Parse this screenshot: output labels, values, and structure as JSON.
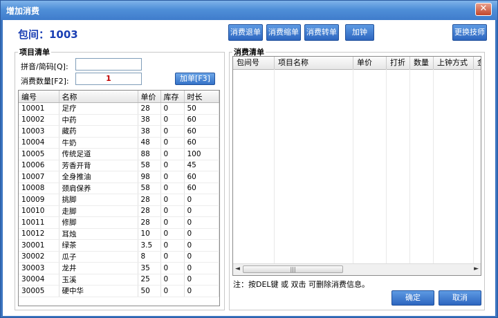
{
  "window": {
    "title": "增加消费",
    "close_glyph": "✕"
  },
  "room": {
    "title": "包间：1003"
  },
  "toolbar": {
    "buttons": [
      "消费退单",
      "消费缩单",
      "消费转单",
      "加钟",
      "更换技师"
    ]
  },
  "item_list": {
    "group_title": "项目清单",
    "pinyin_label": "拼音/简码[Q]:",
    "pinyin_value": "",
    "qty_label": "消费数量[F2]:",
    "qty_value": "1",
    "add_button": "加单[F3]",
    "columns": [
      "编号",
      "名称",
      "单价",
      "库存",
      "时长"
    ],
    "rows": [
      [
        "10001",
        "足疗",
        "28",
        "0",
        "50"
      ],
      [
        "10002",
        "中药",
        "38",
        "0",
        "60"
      ],
      [
        "10003",
        "藏药",
        "38",
        "0",
        "60"
      ],
      [
        "10004",
        "牛奶",
        "48",
        "0",
        "60"
      ],
      [
        "10005",
        "传统足道",
        "88",
        "0",
        "100"
      ],
      [
        "10006",
        "芳香开背",
        "58",
        "0",
        "45"
      ],
      [
        "10007",
        "全身推油",
        "98",
        "0",
        "60"
      ],
      [
        "10008",
        "颈肩保养",
        "58",
        "0",
        "60"
      ],
      [
        "10009",
        "挑脚",
        "28",
        "0",
        "0"
      ],
      [
        "10010",
        "走脚",
        "28",
        "0",
        "0"
      ],
      [
        "10011",
        "修脚",
        "28",
        "0",
        "0"
      ],
      [
        "10012",
        "耳烛",
        "10",
        "0",
        "0"
      ],
      [
        "30001",
        "绿茶",
        "3.5",
        "0",
        "0"
      ],
      [
        "30002",
        "瓜子",
        "8",
        "0",
        "0"
      ],
      [
        "30003",
        "龙井",
        "35",
        "0",
        "0"
      ],
      [
        "30004",
        "玉溪",
        "25",
        "0",
        "0"
      ],
      [
        "30005",
        "硬中华",
        "50",
        "0",
        "0"
      ]
    ]
  },
  "consumption": {
    "group_title": "消费清单",
    "columns": [
      "包间号",
      "项目名称",
      "单价",
      "打折",
      "数量",
      "上钟方式",
      "金"
    ],
    "scroll_thumb": "|||",
    "note": "注：按DEL键 或 双击 可删除消费信息。"
  },
  "actions": {
    "ok": "确定",
    "cancel": "取消"
  },
  "colors": {
    "title_bar": "#4f8fd8",
    "button": "#2d66c0",
    "room_title": "#1a3fb4",
    "qty_value": "#c00000"
  }
}
